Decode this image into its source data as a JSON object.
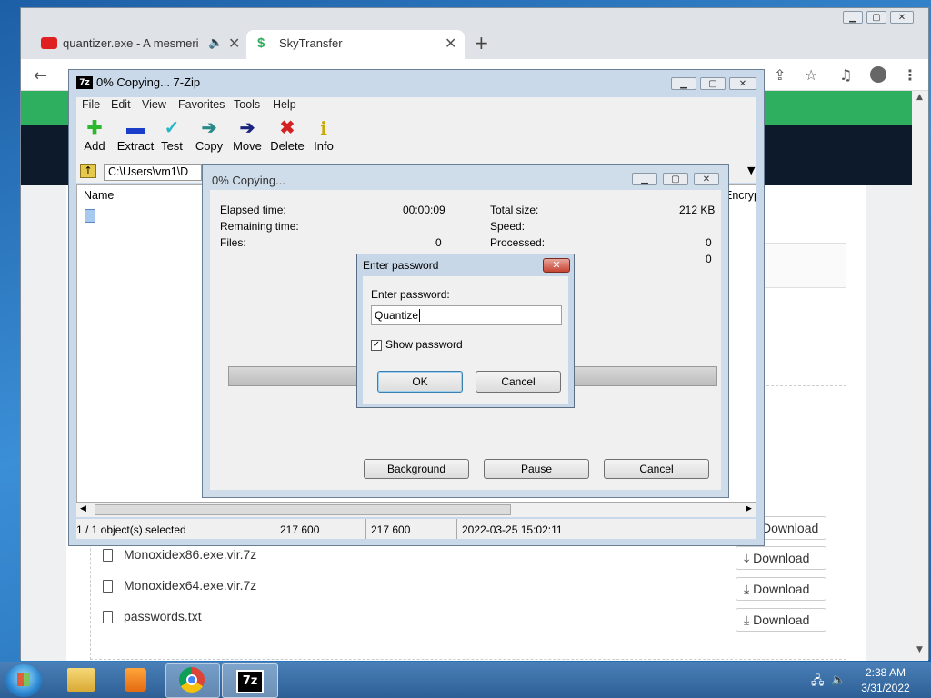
{
  "browser": {
    "tabs": [
      {
        "label": "quantizer.exe - A mesmerizin"
      },
      {
        "label": "SkyTransfer"
      }
    ],
    "new_tab_glyph": "+",
    "close_glyph": "✕",
    "toolbar_icons": [
      "back-icon",
      "share-icon",
      "star-icon",
      "media-icon",
      "profile-icon",
      "menu-icon"
    ]
  },
  "page": {
    "files": [
      {
        "name": "Monoxidex86.exe.vir.7z",
        "action": "Download"
      },
      {
        "name": "Monoxidex64.exe.vir.7z",
        "action": "Download"
      },
      {
        "name": "passwords.txt",
        "action": "Download"
      }
    ],
    "partial_download_label": "Download"
  },
  "sevenzip": {
    "title": "0% Copying... 7-Zip",
    "app_icon_text": "7z",
    "menu": [
      "File",
      "Edit",
      "View",
      "Favorites",
      "Tools",
      "Help"
    ],
    "tools": [
      {
        "label": "Add",
        "glyph": "✚",
        "color": "#2db82d"
      },
      {
        "label": "Extract",
        "glyph": "▬",
        "color": "#1a3ec9"
      },
      {
        "label": "Test",
        "glyph": "✓",
        "color": "#25b5c9"
      },
      {
        "label": "Copy",
        "glyph": "➔",
        "color": "#2a8a8a"
      },
      {
        "label": "Move",
        "glyph": "➔",
        "color": "#1a237e"
      },
      {
        "label": "Delete",
        "glyph": "✖",
        "color": "#d32020"
      },
      {
        "label": "Info",
        "glyph": "i",
        "color": "#c9a800"
      }
    ],
    "address": "C:\\Users\\vm1\\D",
    "columns": {
      "name": "Name",
      "encrypted": "Encrypte"
    },
    "status": {
      "selected": "1 / 1 object(s) selected",
      "size": "217 600",
      "packed": "217 600",
      "modified": "2022-03-25 15:02:11"
    }
  },
  "progress": {
    "title": "0% Copying...",
    "elapsed_label": "Elapsed time:",
    "elapsed_value": "00:00:09",
    "remaining_label": "Remaining time:",
    "files_label": "Files:",
    "files_value": "0",
    "total_label": "Total size:",
    "total_value": "212 KB",
    "speed_label": "Speed:",
    "processed_label": "Processed:",
    "processed_value": "0",
    "extra_value": "0",
    "progress_fraction": 0,
    "buttons": {
      "background": "Background",
      "pause": "Pause",
      "cancel": "Cancel"
    }
  },
  "password_dialog": {
    "title": "Enter password",
    "prompt": "Enter password:",
    "value": "Quantize",
    "show_password_label": "Show password",
    "show_password_checked": true,
    "ok": "OK",
    "cancel": "Cancel"
  },
  "taskbar": {
    "time": "2:38 AM",
    "date": "3/31/2022",
    "apps": [
      "explorer",
      "media-player",
      "chrome",
      "7-zip"
    ],
    "active_app_label": "7z"
  },
  "colors": {
    "accent_green": "#2eae5f",
    "dark_header": "#0c1a2c",
    "close_red": "#c74433"
  }
}
